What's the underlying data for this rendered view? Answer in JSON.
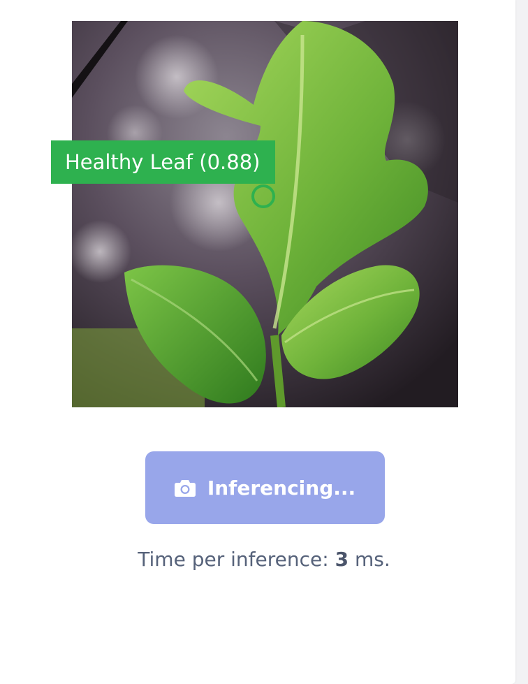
{
  "detection": {
    "label": "Healthy Leaf (0.88)",
    "color": "#2eb14f"
  },
  "button": {
    "label": "Inferencing...",
    "icon": "camera-icon",
    "color": "#98a6ea",
    "state": "disabled"
  },
  "timing": {
    "prefix": "Time per inference:",
    "value": "3",
    "unit": "ms."
  }
}
